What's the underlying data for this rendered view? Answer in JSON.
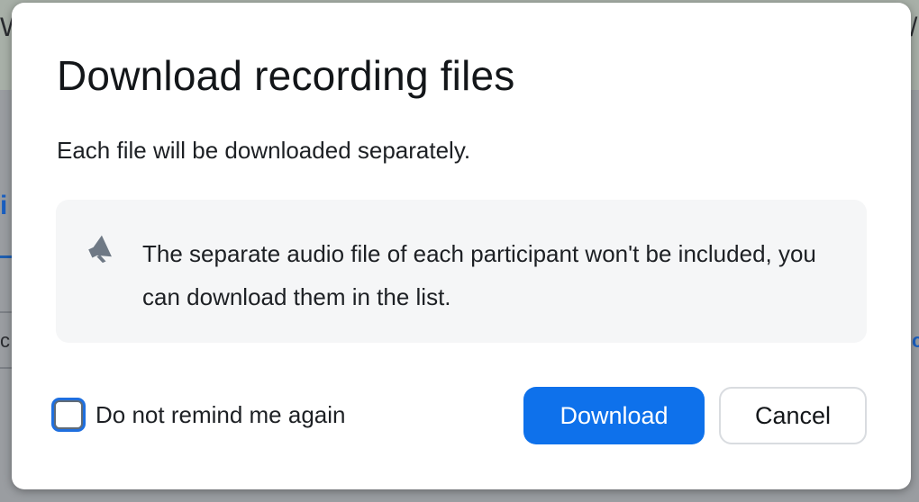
{
  "dialog": {
    "title": "Download recording files",
    "subtitle": "Each file will be downloaded separately.",
    "notice": {
      "icon": "megaphone-icon",
      "text": "The separate audio file of each participant won't be included, you can download them in the list."
    },
    "remind_checkbox": {
      "label": "Do not remind me again",
      "checked": false
    },
    "buttons": {
      "download_label": "Download",
      "cancel_label": "Cancel"
    }
  },
  "colors": {
    "primary": "#0e71eb",
    "notice_background": "#f5f6f7",
    "focus_ring": "#1f6fdf"
  }
}
